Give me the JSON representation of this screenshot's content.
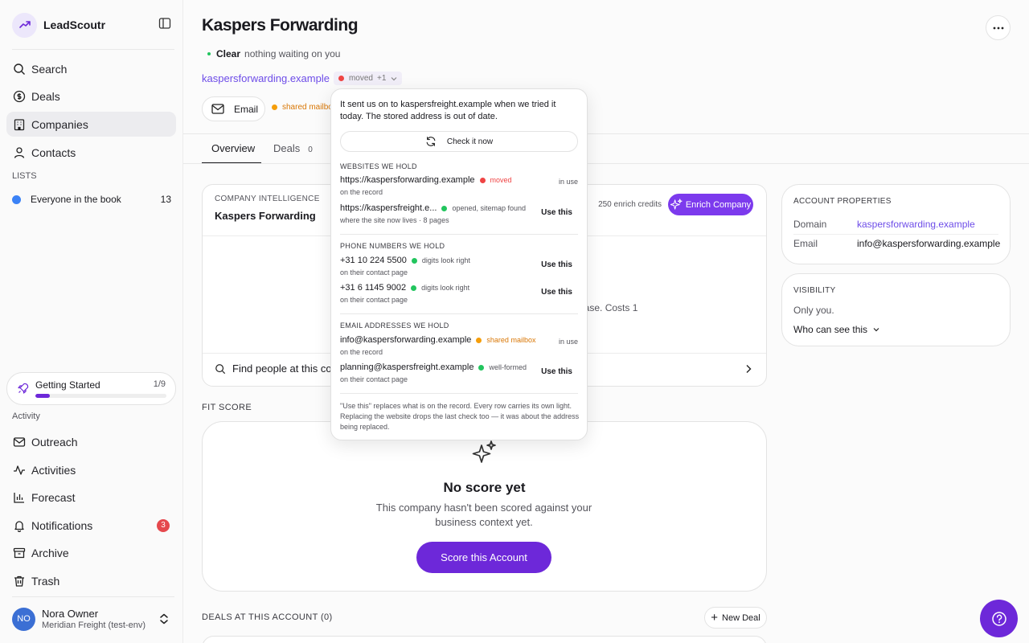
{
  "app": {
    "name": "LeadScoutr"
  },
  "sidebar": {
    "nav": [
      {
        "label": "Search",
        "icon": "search-icon"
      },
      {
        "label": "Deals",
        "icon": "dollar-icon"
      },
      {
        "label": "Companies",
        "icon": "building-icon",
        "active": true
      },
      {
        "label": "Contacts",
        "icon": "person-icon"
      }
    ],
    "lists_header": "LISTS",
    "lists": [
      {
        "label": "Everyone in the book",
        "count": "13"
      }
    ],
    "getting_started": {
      "title": "Getting Started",
      "count": "1/9",
      "progress": 0.11
    },
    "activity_header": "Activity",
    "activity": [
      {
        "label": "Outreach",
        "icon": "mail-icon"
      },
      {
        "label": "Activities",
        "icon": "activity-icon"
      },
      {
        "label": "Forecast",
        "icon": "bar-chart-icon"
      },
      {
        "label": "Notifications",
        "icon": "bell-icon",
        "badge": "3"
      },
      {
        "label": "Archive",
        "icon": "archive-icon"
      },
      {
        "label": "Trash",
        "icon": "trash-icon"
      }
    ],
    "user": {
      "initials": "NO",
      "name": "Nora Owner",
      "org": "Meridian Freight (test-env)"
    }
  },
  "header": {
    "title": "Kaspers Forwarding",
    "status_main": "Clear",
    "status_sub": "nothing waiting on you",
    "domain": "kaspersforwarding.example",
    "domain_tag": "moved",
    "domain_more": "+1",
    "email_button": "Email",
    "email_tag": "shared mailbox"
  },
  "tabs": [
    {
      "label": "Overview",
      "active": true
    },
    {
      "label": "Deals",
      "count": "0"
    }
  ],
  "intel": {
    "label": "COMPANY INTELLIGENCE",
    "name": "Kaspers Forwarding",
    "credits": "250 enrich credits",
    "enrich_button": "Enrich Company",
    "desc_fragment": "base. Costs 1",
    "find_people": "Find people at this compa"
  },
  "fit_score": {
    "label": "FIT SCORE",
    "title": "No score yet",
    "desc": "This company hasn't been scored against your business context yet.",
    "button": "Score this Account"
  },
  "deals": {
    "label": "DEALS AT THIS ACCOUNT (0)",
    "new_button": "New Deal"
  },
  "account": {
    "label": "ACCOUNT PROPERTIES",
    "props": [
      {
        "key": "Domain",
        "value": "kaspersforwarding.example"
      },
      {
        "key": "Email",
        "value": "info@kaspersforwarding.example"
      }
    ]
  },
  "visibility": {
    "label": "VISIBILITY",
    "value": "Only you.",
    "dropdown": "Who can see this"
  },
  "popover": {
    "note": "It sent us on to kaspersfreight.example when we tried it today. The stored address is out of date.",
    "check_button": "Check it now",
    "websites_header": "WEBSITES WE HOLD",
    "websites": [
      {
        "value": "https://kaspersforwarding.example",
        "tag": "moved",
        "sub": "on the record",
        "status": "in use"
      },
      {
        "value": "https://kaspersfreight.e...",
        "tag": "opened, sitemap found",
        "sub": "where the site now lives · 8 pages",
        "action": "Use this"
      }
    ],
    "phones_header": "PHONE NUMBERS WE HOLD",
    "phones": [
      {
        "value": "+31 10 224 5500",
        "tag": "digits look right",
        "sub": "on their contact page",
        "action": "Use this"
      },
      {
        "value": "+31 6 1145 9002",
        "tag": "digits look right",
        "sub": "on their contact page",
        "action": "Use this"
      }
    ],
    "emails_header": "EMAIL ADDRESSES WE HOLD",
    "emails": [
      {
        "value": "info@kaspersforwarding.example",
        "tag": "shared mailbox",
        "sub": "on the record",
        "status": "in use"
      },
      {
        "value": "planning@kaspersfreight.example",
        "tag": "well-formed",
        "sub": "on their contact page",
        "action": "Use this"
      }
    ],
    "footer": "\"Use this\" replaces what is on the record. Every row carries its own light. Replacing the website drops the last check too — it was about the address being replaced."
  },
  "colors": {
    "accent": "#6d28d9",
    "link": "#6d4ce8",
    "danger": "#ef4444",
    "ok": "#22c55e",
    "warn": "#f59e0b"
  }
}
